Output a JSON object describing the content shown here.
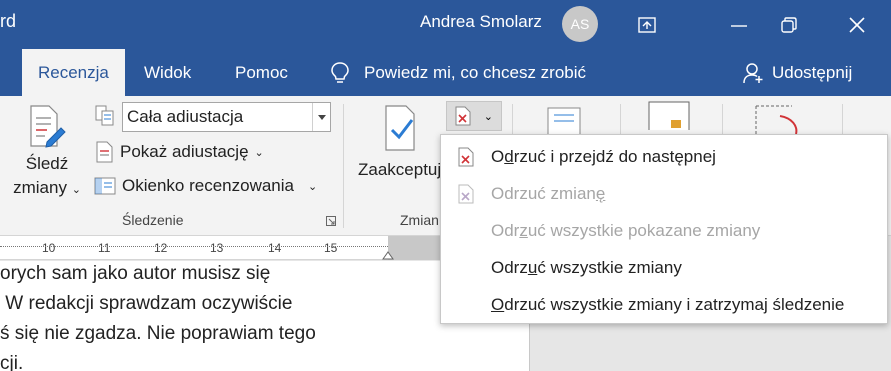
{
  "titlebar": {
    "app_fragment": "rd",
    "user_name": "Andrea Smolarz",
    "avatar_initials": "AS"
  },
  "tabs": {
    "recenzja": "Recenzja",
    "widok": "Widok",
    "pomoc": "Pomoc",
    "tell_me": "Powiedz mi, co chcesz zrobić",
    "share": "Udostępnij"
  },
  "ribbon": {
    "track_changes_line1": "Śledź",
    "track_changes_line2": "zmiany",
    "markup_combo_value": "Cała adiustacja",
    "show_markup": "Pokaż adiustację",
    "reviewing_pane": "Okienko recenzowania",
    "group_tracking": "Śledzenie",
    "accept_label": "Zaakceptuj",
    "group_changes": "Zmian"
  },
  "ruler": {
    "ticks": [
      "10",
      "11",
      "12",
      "13",
      "14",
      "15"
    ]
  },
  "document": {
    "lines": [
      "orych sam jako autor musisz się",
      " W redakcji sprawdzam oczywiście",
      "ś się nie zgadza. Nie poprawiam tego",
      "cji."
    ]
  },
  "reject_menu": {
    "items": [
      {
        "pre": "O",
        "ul": "d",
        "post": "rzuć i przejdź do następnej",
        "enabled": true
      },
      {
        "pre": "Odrzuć zmian",
        "ul": "ę",
        "post": "",
        "enabled": false
      },
      {
        "pre": "Odr",
        "ul": "z",
        "post": "uć wszystkie pokazane zmiany",
        "enabled": false
      },
      {
        "pre": "Odrz",
        "ul": "u",
        "post": "ć wszystkie zmiany",
        "enabled": true
      },
      {
        "pre": "",
        "ul": "O",
        "post": "drzuć wszystkie zmiany i zatrzymaj śledzenie",
        "enabled": true
      }
    ]
  },
  "colors": {
    "word_blue": "#2b579a",
    "reject_red": "#d13438",
    "accept_blue": "#2b7cd3",
    "disabled_text": "#a6a6a6"
  }
}
